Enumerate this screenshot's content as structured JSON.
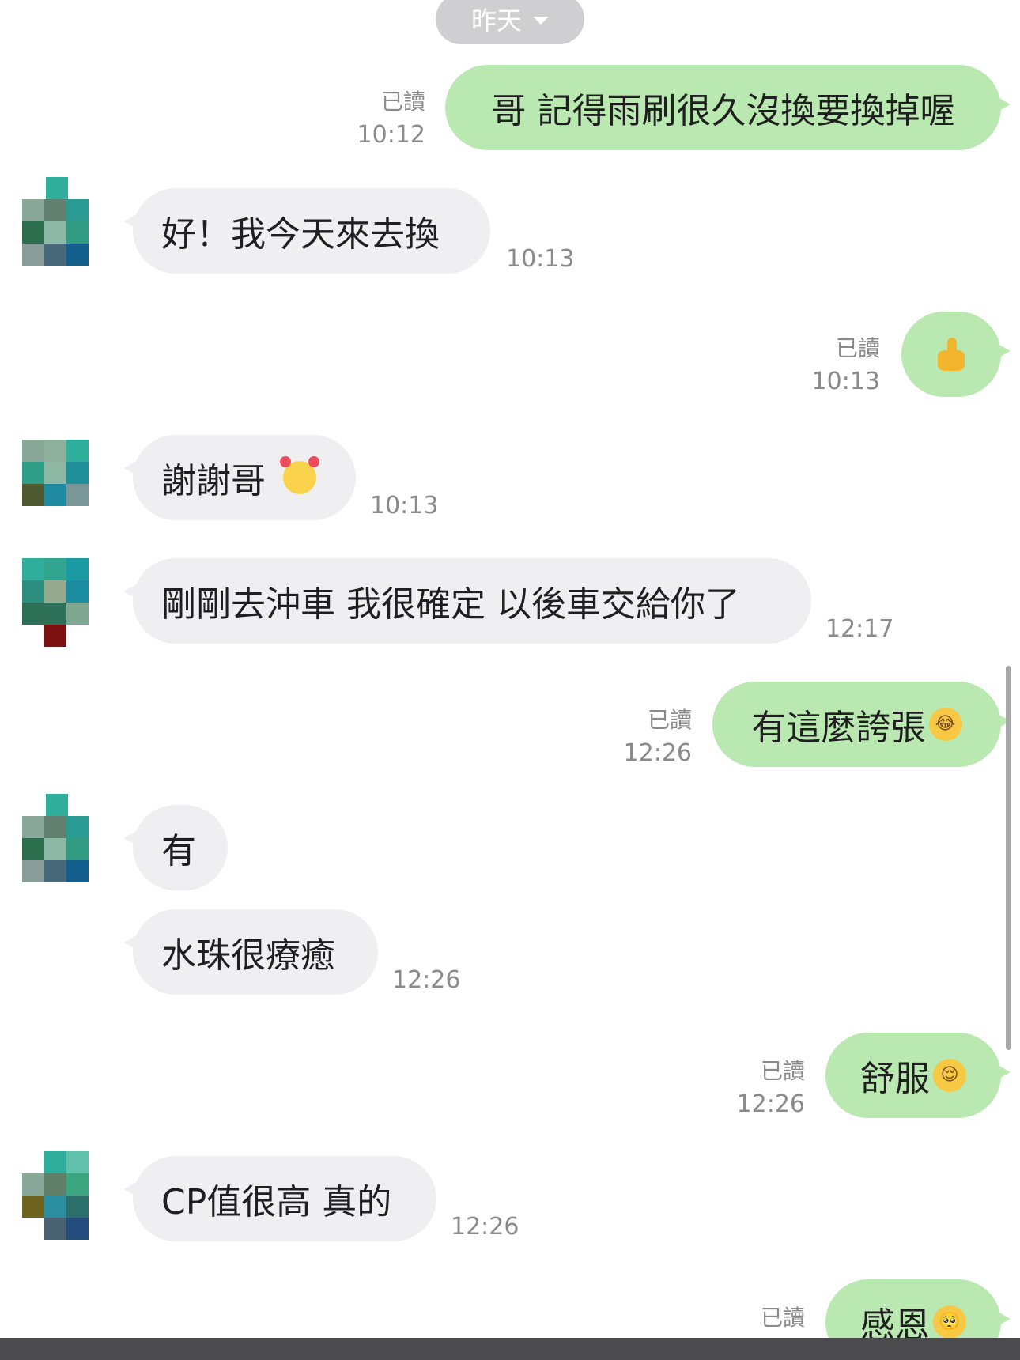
{
  "date_separator": {
    "label": "昨天"
  },
  "messages": [
    {
      "direction": "out",
      "text": "哥 記得雨刷很久沒換要換掉喔",
      "read": "已讀",
      "time": "10:12"
    },
    {
      "direction": "in",
      "text": "好！我今天來去換",
      "time": "10:13"
    },
    {
      "direction": "out",
      "sticker": "thumbs-up-emoji",
      "read": "已讀",
      "time": "10:13"
    },
    {
      "direction": "in",
      "text": "謝謝哥",
      "emoji": "love-chick-emoji",
      "time": "10:13"
    },
    {
      "direction": "in",
      "text": "剛剛去沖車 我很確定 以後車交給你了",
      "time": "12:17"
    },
    {
      "direction": "out",
      "text": "有這麼誇張",
      "emoji": "tears-of-joy-emoji",
      "read": "已讀",
      "time": "12:26"
    },
    {
      "direction": "in",
      "text": "有"
    },
    {
      "direction": "in",
      "text": "水珠很療癒",
      "time": "12:26"
    },
    {
      "direction": "out",
      "text": "舒服",
      "emoji": "relieved-face-emoji",
      "read": "已讀",
      "time": "12:26"
    },
    {
      "direction": "in",
      "text": "CP值很高 真的",
      "time": "12:26"
    },
    {
      "direction": "out",
      "text": "感恩",
      "emoji": "pleading-face-emoji",
      "read": "已讀"
    }
  ],
  "colors": {
    "outgoing_bubble": "#b9e8b1",
    "incoming_bubble": "#efeff1",
    "meta_text": "#8a8a8a",
    "date_pill": "#cfcfd1"
  }
}
